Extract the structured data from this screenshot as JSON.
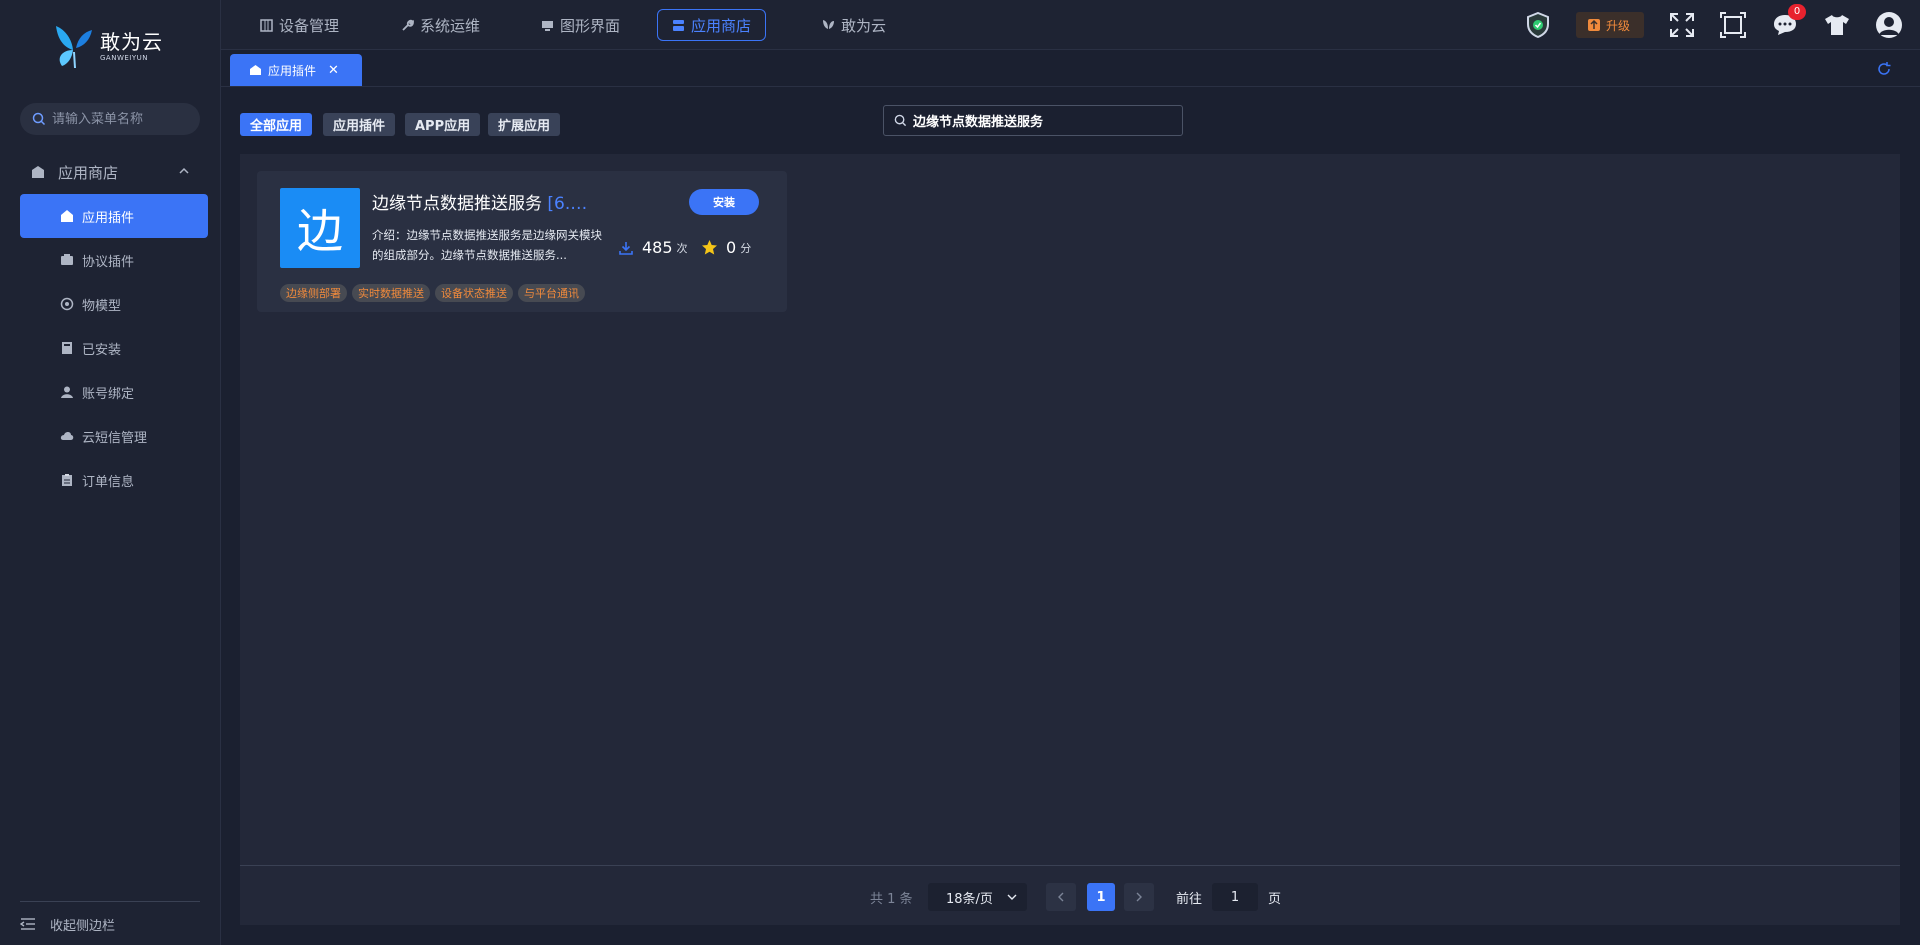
{
  "brand": {
    "name_cn": "敢为云",
    "name_en": "GANWEIYUN"
  },
  "sidebar": {
    "search_placeholder": "请输入菜单名称",
    "group_label": "应用商店",
    "items": [
      {
        "label": "应用插件",
        "icon": "home-icon",
        "active": true
      },
      {
        "label": "协议插件",
        "icon": "plugin-icon",
        "active": false
      },
      {
        "label": "物模型",
        "icon": "model-icon",
        "active": false
      },
      {
        "label": "已安装",
        "icon": "book-icon",
        "active": false
      },
      {
        "label": "账号绑定",
        "icon": "user-icon",
        "active": false
      },
      {
        "label": "云短信管理",
        "icon": "cloud-icon",
        "active": false
      },
      {
        "label": "订单信息",
        "icon": "clipboard-icon",
        "active": false
      }
    ],
    "collapse_label": "收起侧边栏"
  },
  "topnav": {
    "tabs": [
      {
        "label": "设备管理",
        "icon": "device-icon"
      },
      {
        "label": "系统运维",
        "icon": "wrench-icon"
      },
      {
        "label": "图形界面",
        "icon": "monitor-icon"
      },
      {
        "label": "应用商店",
        "icon": "store-icon",
        "active": true
      },
      {
        "label": "敢为云",
        "icon": "butterfly-icon"
      }
    ],
    "upgrade_label": "升级",
    "notification_count": "0"
  },
  "open_tabs": [
    {
      "label": "应用插件",
      "close": "✕"
    }
  ],
  "filters": [
    "全部应用",
    "应用插件",
    "APP应用",
    "扩展应用"
  ],
  "search": {
    "value": "边缘节点数据推送服务"
  },
  "apps": [
    {
      "logo_char": "边",
      "title": "边缘节点数据推送服务",
      "version": "[6.…",
      "desc": "介绍：边缘节点数据推送服务是边缘网关模块的组成部分。边缘节点数据推送服务...",
      "install_label": "安装",
      "downloads": "485",
      "downloads_unit": "次",
      "rating": "0",
      "rating_unit": "分",
      "tags": [
        "边缘侧部署",
        "实时数据推送",
        "设备状态推送",
        "与平台通讯"
      ]
    }
  ],
  "pagination": {
    "total": "共 1 条",
    "page_size": "18条/页",
    "current": "1",
    "goto_label": "前往",
    "goto_value": "1",
    "page_label": "页"
  },
  "colors": {
    "accent": "#3b74f6",
    "tag_text": "#f08a3c",
    "star": "#f5c518"
  }
}
